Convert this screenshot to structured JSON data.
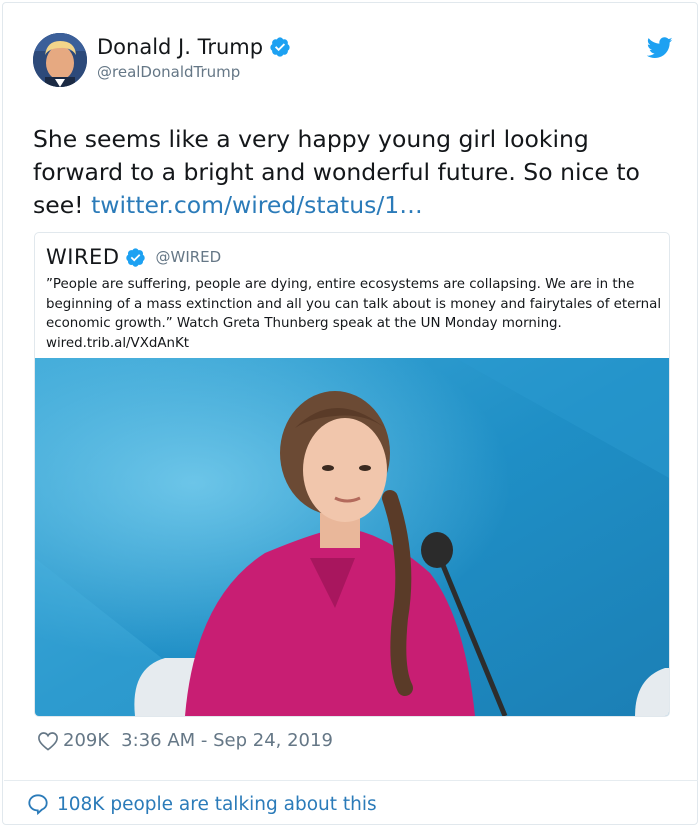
{
  "author": {
    "name": "Donald J. Trump",
    "handle": "@realDonaldTrump",
    "verified": true
  },
  "tweet": {
    "text": "She seems like a very happy young girl looking forward to a bright and wonderful future. So nice to see! ",
    "link": "twitter.com/wired/status/1…"
  },
  "quoted_tweet": {
    "name": "WIRED",
    "handle": "@WIRED",
    "verified": true,
    "text": "”People are suffering, people are dying, entire ecosystems are collapsing. We are in the beginning of a mass extinction and all you can talk about is money and fairytales of eternal economic growth.” Watch Greta Thunberg speak at the UN Monday morning.",
    "link": "wired.trib.al/VXdAnKt"
  },
  "meta": {
    "likes": "209K",
    "timestamp": "3:36 AM - Sep 24, 2019"
  },
  "footer": {
    "text": "108K people are talking about this"
  },
  "colors": {
    "twitter_blue": "#1da1f2",
    "link_blue": "#2b7bb9",
    "secondary_text": "#657786",
    "border": "#e1e8ed"
  },
  "icons": {
    "verified": "verified-badge-icon",
    "brand": "twitter-bird-icon",
    "like": "heart-outline-icon",
    "replies": "speech-bubble-icon"
  }
}
